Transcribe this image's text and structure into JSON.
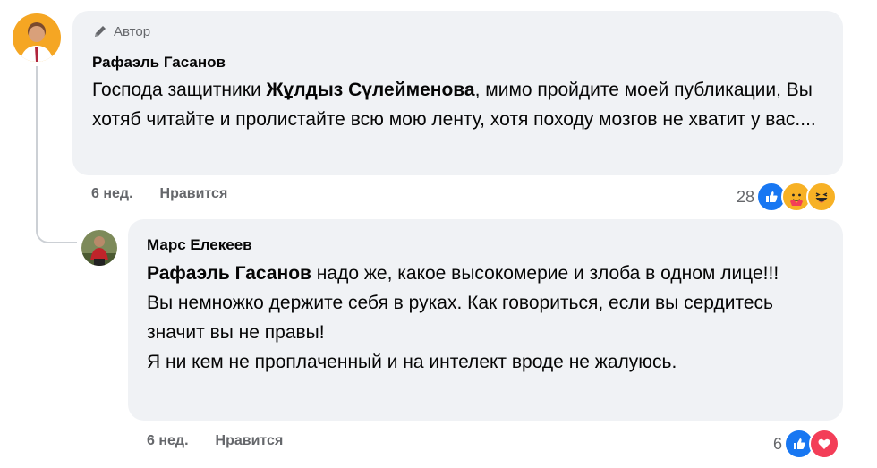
{
  "comment1": {
    "badge": "Автор",
    "author": "Рафаэль Гасанов",
    "text_pre": "Господа защитники ",
    "text_bold": "Жұлдыз Сүлейменова",
    "text_post": ", мимо пройдите моей публикации, Вы хотяб читайте и пролистайте всю мою ленту, хотя походу мозгов не хватит у вас....",
    "time": "6 нед.",
    "like_label": "Нравится",
    "reaction_count": "28",
    "reactions": [
      "like-icon",
      "care-icon",
      "haha-icon"
    ]
  },
  "comment2": {
    "author": "Марс Елекеев",
    "mention": "Рафаэль Гасанов",
    "line1": " надо же, какое высокомерие и злоба в одном лице!!!",
    "line2": "Вы немножко держите себя в руках. Как говориться, если вы сердитесь значит вы не правы!",
    "line3": "Я ни кем не проплаченный и на интелект вроде не жалуюсь.",
    "time": "6 нед.",
    "like_label": "Нравится",
    "reaction_count": "6",
    "reactions": [
      "like-icon",
      "love-icon"
    ]
  },
  "colors": {
    "like": "#1877f2",
    "love": "#f33e58",
    "haha": "#f7b125",
    "bubble": "#f0f2f5",
    "meta": "#65676b"
  }
}
